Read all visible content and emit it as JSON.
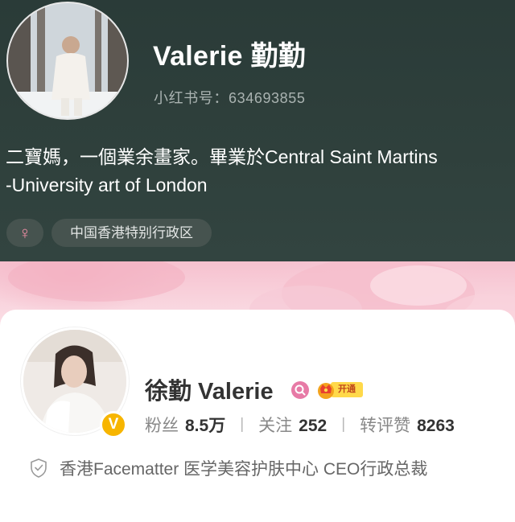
{
  "xhs_profile": {
    "name": "Valerie 勤勤",
    "id_text": "小红书号：634693855",
    "bio_line1": "二寶媽，一個業余畫家。畢業於Central Saint Martins",
    "bio_line2": "-University art of London",
    "tags": {
      "gender_symbol": "♀",
      "region": "中国香港特别行政区"
    },
    "colors": {
      "background": "#2e3f3b",
      "tag_bg": "#46534f",
      "gender_icon": "#f08ea6"
    }
  },
  "weibo_profile": {
    "name": "徐勤 Valerie",
    "verified_badge": "V",
    "vip_label": "开通",
    "stats": {
      "followers_label": "粉丝",
      "followers_value": "8.5万",
      "following_label": "关注",
      "following_value": "252",
      "engagement_label": "转评赞",
      "engagement_value": "8263",
      "separator": "|"
    },
    "verification": "香港Facematter 医学美容护肤中心 CEO行政总裁",
    "icons": [
      "shield-check-icon",
      "search-badge-icon",
      "vip-crown-icon"
    ],
    "colors": {
      "verified_badge": "#f7b500",
      "search_badge": "#e77aa6",
      "vip": "#ffd94a"
    }
  }
}
